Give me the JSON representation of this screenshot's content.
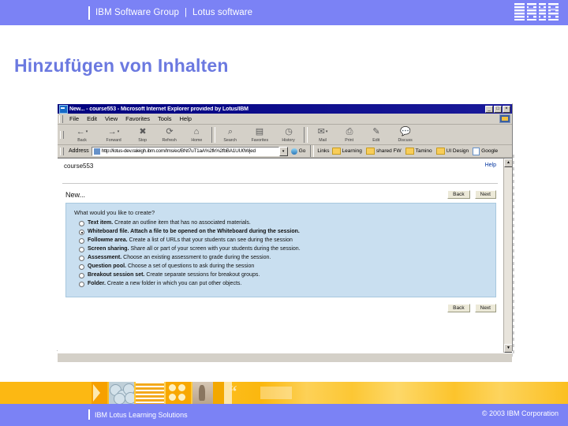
{
  "header": {
    "brand": "IBM Software Group",
    "separator": "|",
    "product": "Lotus software",
    "logo_alt": "IBM"
  },
  "slide": {
    "title": "Hinzufügen von Inhalten"
  },
  "browser": {
    "window_title": "New... - course553 - Microsoft Internet Explorer provided by Lotus/IBM",
    "window_buttons": {
      "minimize": "_",
      "maximize": "□",
      "close": "×"
    },
    "menus": [
      "File",
      "Edit",
      "View",
      "Favorites",
      "Tools",
      "Help"
    ],
    "toolbar": [
      {
        "label": "Back",
        "icon": "back-arrow-icon",
        "glyph": "←",
        "has_caret": true
      },
      {
        "label": "Forward",
        "icon": "forward-arrow-icon",
        "glyph": "→",
        "has_caret": true
      },
      {
        "label": "Stop",
        "icon": "stop-icon",
        "glyph": "✖",
        "has_caret": false
      },
      {
        "label": "Refresh",
        "icon": "refresh-icon",
        "glyph": "⟳",
        "has_caret": false
      },
      {
        "label": "Home",
        "icon": "home-icon",
        "glyph": "⌂",
        "has_caret": false
      },
      {
        "label": "Search",
        "icon": "search-icon",
        "glyph": "⌕",
        "has_caret": false
      },
      {
        "label": "Favorites",
        "icon": "favorites-icon",
        "glyph": "▤",
        "has_caret": false
      },
      {
        "label": "History",
        "icon": "history-icon",
        "glyph": "◷",
        "has_caret": false
      },
      {
        "label": "Mail",
        "icon": "mail-icon",
        "glyph": "✉",
        "has_caret": true
      },
      {
        "label": "Print",
        "icon": "print-icon",
        "glyph": "🖶",
        "has_caret": false
      },
      {
        "label": "Edit",
        "icon": "edit-icon",
        "glyph": "✎",
        "has_caret": false
      },
      {
        "label": "Discuss",
        "icon": "discuss-icon",
        "glyph": "✎",
        "has_caret": false
      }
    ],
    "address": {
      "label": "Address",
      "url": "http://lotus-dev.raleigh.ibm.com/lms/ec/BNt7uT1aA%2fk%2fbBA1UU0Wjed",
      "go_label": "Go",
      "links_label": "Links",
      "links": [
        {
          "label": "Learning",
          "icon": "folder-icon"
        },
        {
          "label": "shared FW",
          "icon": "folder-icon"
        },
        {
          "label": "Tamino",
          "icon": "folder-icon"
        },
        {
          "label": "UI Design",
          "icon": "folder-icon"
        },
        {
          "label": "Google",
          "icon": "page-icon"
        }
      ]
    }
  },
  "page": {
    "breadcrumb": "course553",
    "help_link": "Help",
    "heading": "New...",
    "back_label": "Back",
    "next_label": "Next",
    "question": "What would you like to create?",
    "options": [
      {
        "title": "Text item.",
        "description": " Create an outline item that has no associated materials.",
        "selected": false
      },
      {
        "title": "Whiteboard file.",
        "description": " Attach a file to be opened on the Whiteboard during the session.",
        "selected": true
      },
      {
        "title": "Followme area.",
        "description": " Create a list of URLs that your students can see during the session",
        "selected": false
      },
      {
        "title": "Screen sharing.",
        "description": " Share all or part of your screen with your students during the session.",
        "selected": false
      },
      {
        "title": "Assessment.",
        "description": " Choose an existing assessment to grade during the session.",
        "selected": false
      },
      {
        "title": "Question pool.",
        "description": " Choose a set of questions to ask during the session",
        "selected": false
      },
      {
        "title": "Breakout session set.",
        "description": " Create separate sessions for breakout groups.",
        "selected": false
      },
      {
        "title": "Folder.",
        "description": " Create a new folder in which you can put other objects.",
        "selected": false
      }
    ],
    "footer_back_label": "Back",
    "footer_next_label": "Next"
  },
  "footer": {
    "left": "IBM Lotus Learning Solutions",
    "right": "© 2003 IBM Corporation"
  },
  "colors": {
    "band_blue": "#7b82f5",
    "title_blue": "#6b79e0",
    "gold": "#fcb813",
    "panel_blue": "#c9dff0",
    "titlebar_navy": "#00007e"
  }
}
